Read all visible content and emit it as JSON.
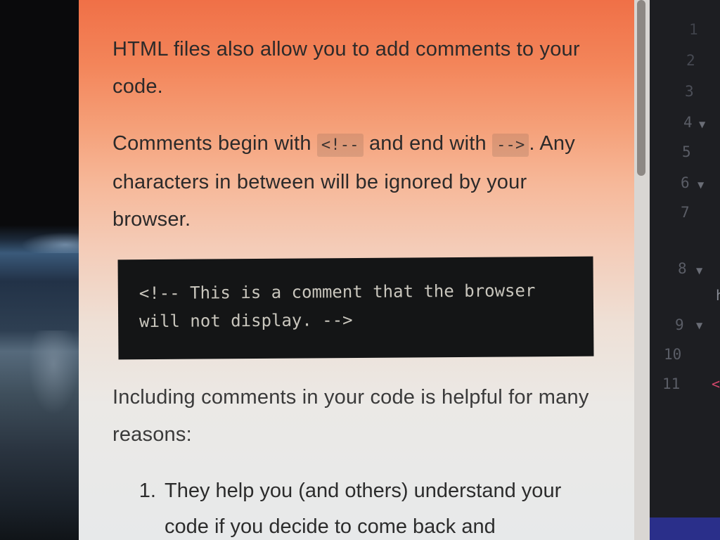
{
  "lesson": {
    "para1": "HTML files also allow you to add comments to your code.",
    "para2": {
      "text_before": "Comments begin with ",
      "code_open": "<!--",
      "text_middle": " and end with ",
      "code_close": "-->",
      "text_after": ". Any characters in between will be ignored by your browser."
    },
    "code_block": "<!-- This is a comment that the browser will not display. -->",
    "para3": "Including comments in your code is helpful for many reasons:",
    "list": [
      "They help you (and others) understand your code if you decide to come back and"
    ]
  },
  "editor": {
    "line_numbers": [
      "1",
      "2",
      "3",
      "4",
      "5",
      "6",
      "7",
      "8",
      "9",
      "10",
      "11"
    ],
    "fold_marker": "▼",
    "partial_chars": {
      "line8": "h",
      "line11": "<"
    }
  },
  "icons": {
    "cursor": "text-cursor-icon"
  },
  "colors": {
    "panel_top": "#f07047",
    "panel_bottom": "#e7e9ea",
    "code_bg": "#141516",
    "editor_bg": "#1d1e22"
  }
}
